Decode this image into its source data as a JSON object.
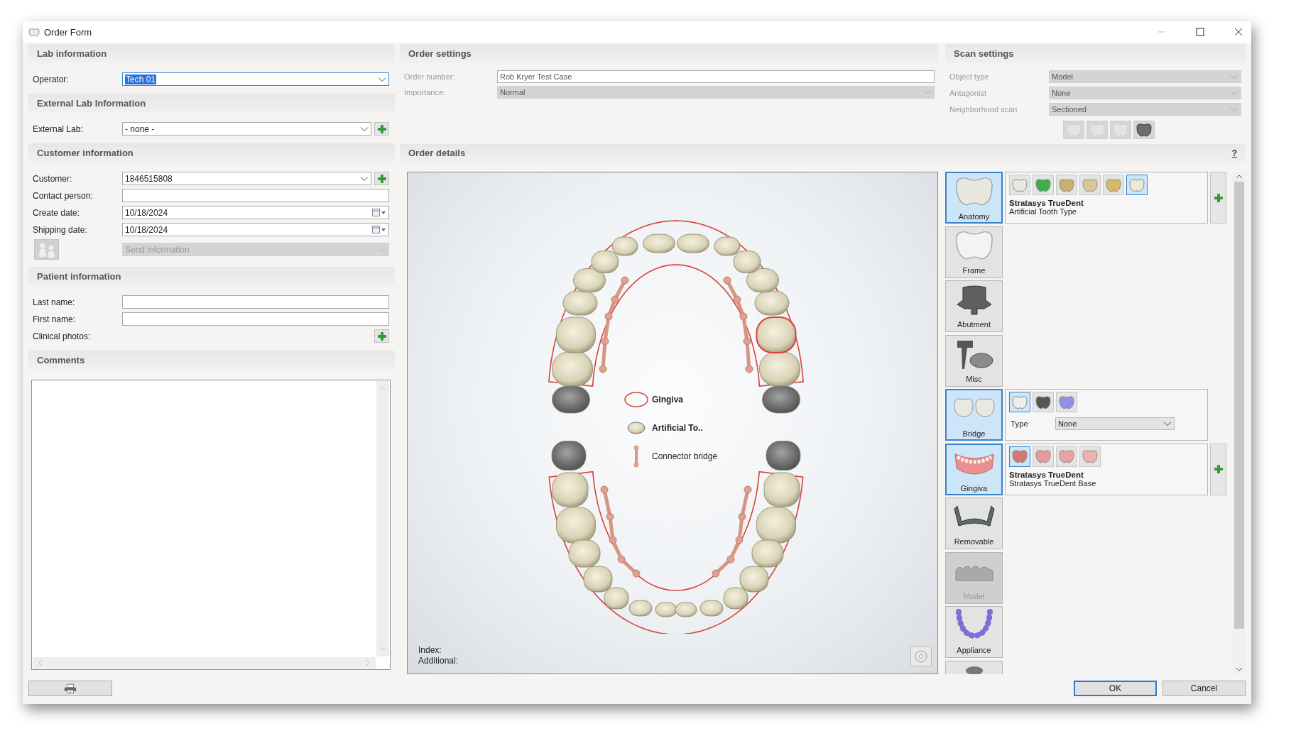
{
  "window": {
    "title": "Order Form"
  },
  "left_sections": [
    {
      "title": "Lab information",
      "fields": [
        {
          "kind": "dropdown",
          "label": "Operator:",
          "value": "Tech 01",
          "highlighted": true,
          "disabled": false
        }
      ]
    },
    {
      "title": "External Lab Information",
      "fields": [
        {
          "kind": "dropdown",
          "label": "External Lab:",
          "value": "- none -",
          "highlighted": false,
          "add": true,
          "disabled": false
        }
      ]
    },
    {
      "title": "Customer information",
      "fields": [
        {
          "kind": "dropdown",
          "label": "Customer:",
          "value": "1846515808",
          "highlighted": false,
          "add": true,
          "disabled": false
        },
        {
          "kind": "text",
          "label": "Contact person:"
        },
        {
          "kind": "date",
          "label": "Create date:",
          "value": "10/18/2024"
        },
        {
          "kind": "date",
          "label": "Shipping date:",
          "value": "10/18/2024"
        },
        {
          "kind": "send",
          "value": "Send information",
          "disabled": true
        }
      ]
    },
    {
      "title": "Patient information",
      "fields": [
        {
          "kind": "text",
          "label": "Last name:"
        },
        {
          "kind": "text",
          "label": "First name:"
        },
        {
          "kind": "add",
          "label": "Clinical photos:"
        }
      ]
    },
    {
      "title": "Comments",
      "fields": [
        {
          "kind": "memo"
        }
      ]
    }
  ],
  "order_settings": {
    "title": "Order settings",
    "fields": [
      {
        "kind": "text",
        "label": "Order number:",
        "value": "Rob Kryer Test Case"
      },
      {
        "kind": "dropdown",
        "label": "Importance:",
        "value": "Normal",
        "disabled": true
      }
    ]
  },
  "scan_settings": {
    "title": "Scan settings",
    "fields": [
      {
        "label": "Object type",
        "value": "Model",
        "disabled": true
      },
      {
        "label": "Antagonist",
        "value": "None",
        "disabled": true
      },
      {
        "label": "Neighborhood scan",
        "value": "Sectioned",
        "disabled": true
      }
    ],
    "scan_buttons": [
      {
        "disabled": true
      },
      {
        "disabled": true
      },
      {
        "disabled": true
      },
      {
        "disabled": false
      }
    ]
  },
  "order_details": {
    "title": "Order details",
    "help": "?",
    "legend": [
      {
        "kind": "gingiva",
        "label": "Gingiva",
        "bold": true
      },
      {
        "kind": "tooth",
        "label": "Artificial To..",
        "bold": true
      },
      {
        "kind": "connector",
        "label": "Connector bridge",
        "bold": false
      }
    ],
    "index_label": "Index:",
    "additional_label": "Additional:",
    "categories": [
      {
        "label": "Anatomy",
        "selected": true,
        "disabled": false,
        "options": {
          "icons": [
            {
              "selected": false
            },
            {
              "selected": false
            },
            {
              "selected": false
            },
            {
              "selected": false
            },
            {
              "selected": false
            },
            {
              "selected": true
            }
          ],
          "title": "Stratasys TrueDent",
          "subtitle": "Artificial Tooth Type",
          "add": true
        }
      },
      {
        "label": "Frame",
        "selected": false,
        "disabled": false
      },
      {
        "label": "Abutment",
        "selected": false,
        "disabled": false
      },
      {
        "label": "Misc",
        "selected": false,
        "disabled": false
      },
      {
        "label": "Bridge",
        "selected": true,
        "disabled": false,
        "options": {
          "icons": [
            {
              "selected": true
            },
            {
              "selected": false
            },
            {
              "selected": false
            }
          ],
          "type_label": "Type",
          "type_value": "None"
        }
      },
      {
        "label": "Gingiva",
        "selected": true,
        "disabled": false,
        "options": {
          "icons": [
            {
              "selected": true
            },
            {
              "selected": false
            },
            {
              "selected": false
            },
            {
              "selected": false
            }
          ],
          "title": "Stratasys TrueDent",
          "subtitle": "Stratasys TrueDent Base",
          "add": true
        }
      },
      {
        "label": "Removable",
        "selected": false,
        "disabled": false
      },
      {
        "label": "Model",
        "selected": false,
        "disabled": true
      },
      {
        "label": "Appliance",
        "selected": false,
        "disabled": false
      },
      {
        "selected": false,
        "disabled": false
      }
    ]
  },
  "buttons": [
    {
      "label": "OK",
      "default": true
    },
    {
      "label": "Cancel",
      "default": false
    }
  ]
}
